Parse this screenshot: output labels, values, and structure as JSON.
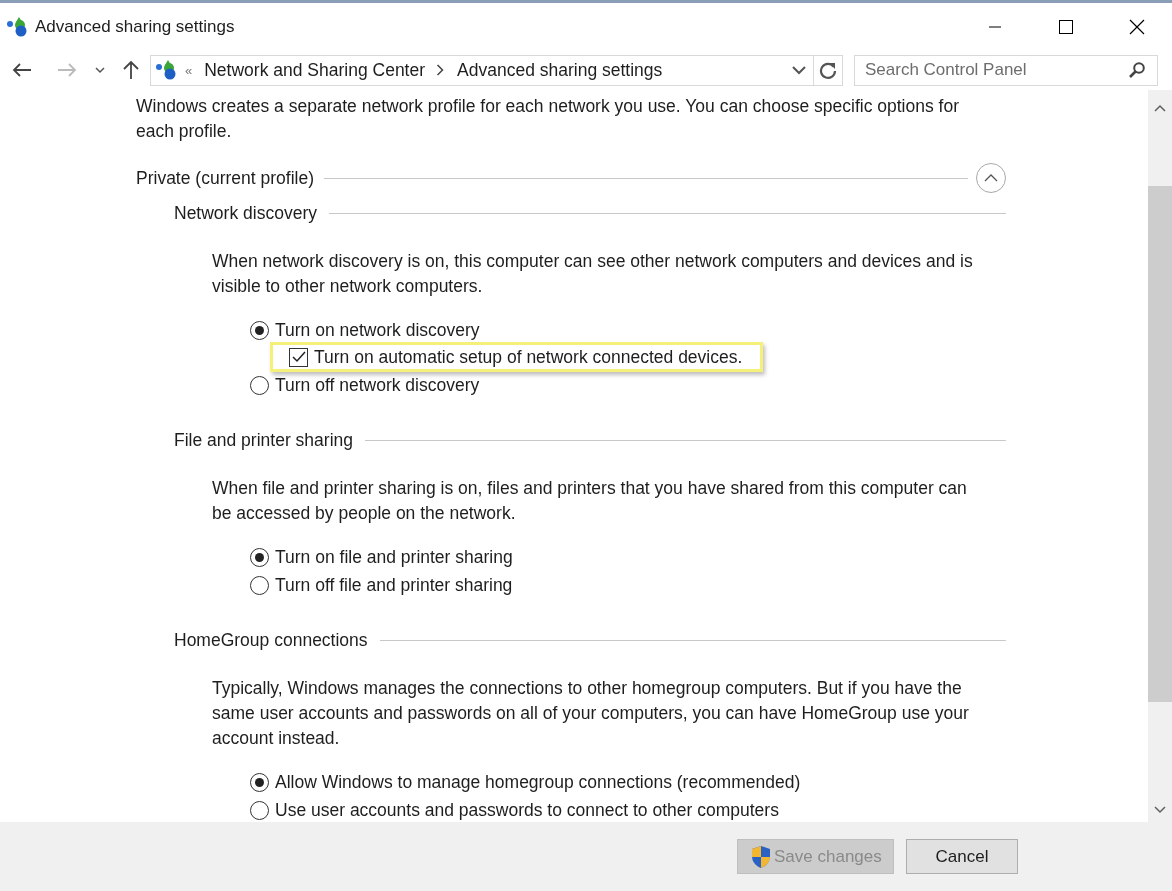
{
  "window": {
    "title": "Advanced sharing settings"
  },
  "address_bar": {
    "overflow_marker": "«",
    "breadcrumbs": [
      "Network and Sharing Center",
      "Advanced sharing settings"
    ]
  },
  "search": {
    "placeholder": "Search Control Panel"
  },
  "intro": "Windows creates a separate network profile for each network you use. You can choose specific options for each profile.",
  "profiles": [
    {
      "label": "Private (current profile)",
      "expanded": true,
      "sections": [
        {
          "title": "Network discovery",
          "description": "When network discovery is on, this computer can see other network computers and devices and is visible to other network computers.",
          "options": [
            {
              "kind": "radio",
              "label": "Turn on network discovery",
              "selected": true,
              "children": [
                {
                  "kind": "checkbox",
                  "label": "Turn on automatic setup of network connected devices.",
                  "checked": true,
                  "highlighted": true
                }
              ]
            },
            {
              "kind": "radio",
              "label": "Turn off network discovery",
              "selected": false
            }
          ]
        },
        {
          "title": "File and printer sharing",
          "description": "When file and printer sharing is on, files and printers that you have shared from this computer can be accessed by people on the network.",
          "options": [
            {
              "kind": "radio",
              "label": "Turn on file and printer sharing",
              "selected": true
            },
            {
              "kind": "radio",
              "label": "Turn off file and printer sharing",
              "selected": false
            }
          ]
        },
        {
          "title": "HomeGroup connections",
          "description": "Typically, Windows manages the connections to other homegroup computers. But if you have the same user accounts and passwords on all of your computers, you can have HomeGroup use your account instead.",
          "options": [
            {
              "kind": "radio",
              "label": "Allow Windows to manage homegroup connections (recommended)",
              "selected": true
            },
            {
              "kind": "radio",
              "label": "Use user accounts and passwords to connect to other computers",
              "selected": false
            }
          ]
        }
      ]
    }
  ],
  "buttons": [
    {
      "label": "Save changes",
      "kind": "elevated",
      "disabled": true
    },
    {
      "label": "Cancel",
      "kind": "plain",
      "disabled": false
    }
  ]
}
